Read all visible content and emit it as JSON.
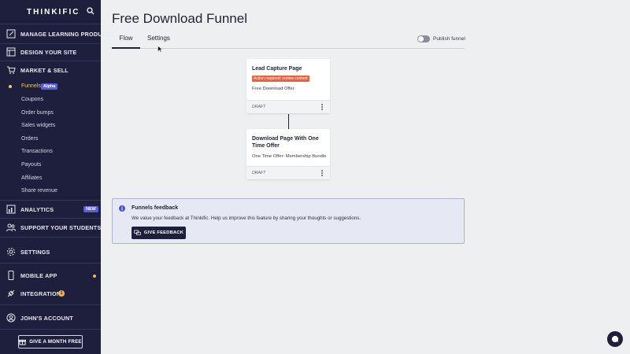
{
  "brand": {
    "name": "THINKIFIC"
  },
  "sidebar": {
    "nav": [
      {
        "label": "MANAGE LEARNING PRODUCTS",
        "icon": "edit-icon"
      },
      {
        "label": "DESIGN YOUR SITE",
        "icon": "layout-icon"
      },
      {
        "label": "MARKET & SELL",
        "icon": "cart-icon"
      },
      {
        "label": "ANALYTICS",
        "icon": "chart-icon",
        "badge": "NEW"
      },
      {
        "label": "SUPPORT YOUR STUDENTS",
        "icon": "users-icon"
      },
      {
        "label": "SETTINGS",
        "icon": "gear-icon"
      },
      {
        "label": "MOBILE APP",
        "icon": "phone-icon"
      },
      {
        "label": "INTEGRATIONS",
        "icon": "plug-icon",
        "badge": "1"
      },
      {
        "label": "JOHN'S ACCOUNT",
        "icon": "account-icon"
      }
    ],
    "market_sub": [
      {
        "label": "Funnels",
        "active": true,
        "badge": "Alpha"
      },
      {
        "label": "Coupons"
      },
      {
        "label": "Order bumps"
      },
      {
        "label": "Sales widgets"
      },
      {
        "label": "Orders"
      },
      {
        "label": "Transactions"
      },
      {
        "label": "Payouts"
      },
      {
        "label": "Affiliates"
      },
      {
        "label": "Share revenue"
      }
    ],
    "gift_button": "GIVE A MONTH FREE"
  },
  "page": {
    "title": "Free Download Funnel",
    "tabs": [
      "Flow",
      "Settings"
    ],
    "publish_label": "Publish funnel"
  },
  "cards": [
    {
      "title": "Lead Capture Page",
      "warning": "Action required: review content",
      "subtitle": "Free Download Offer",
      "status": "DRAFT"
    },
    {
      "title": "Download Page With One Time Offer",
      "subtitle": "One Time Offer: Membership Bundle",
      "status": "DRAFT"
    }
  ],
  "feedback": {
    "title": "Funnels feedback",
    "text": "We value your feedback at Thinkific. Help us improve this feature by sharing your thoughts or suggestions.",
    "button": "GIVE FEEDBACK"
  },
  "colors": {
    "sidebar_bg": "#1e1f3d",
    "accent": "#5a5fd6",
    "warning": "#e8623b",
    "active_gold": "#f4c95d"
  }
}
